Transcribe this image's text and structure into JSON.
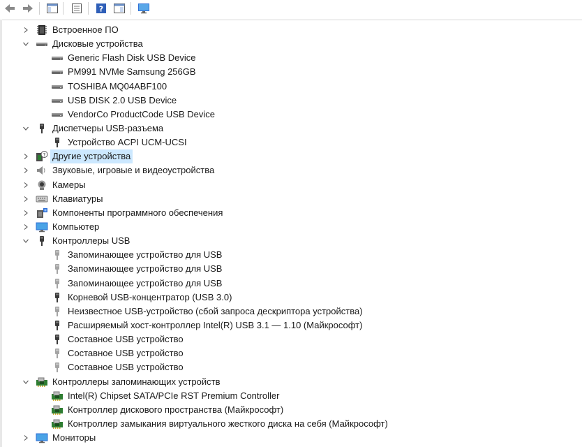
{
  "toolbar": {
    "buttons": [
      {
        "name": "back-icon"
      },
      {
        "name": "forward-icon"
      },
      {
        "name": "show-hide-console-tree-icon"
      },
      {
        "name": "properties-icon"
      },
      {
        "name": "help-icon"
      },
      {
        "name": "show-hide-action-pane-icon"
      },
      {
        "name": "monitor-icon"
      }
    ]
  },
  "tree": {
    "rows": [
      {
        "label": "Встроенное ПО",
        "level": 0,
        "expanded": false,
        "icon": "firmware-icon"
      },
      {
        "label": "Дисковые устройства",
        "level": 0,
        "expanded": true,
        "icon": "disk-drive-icon"
      },
      {
        "label": "Generic Flash Disk USB Device",
        "level": 1,
        "icon": "disk-drive-icon"
      },
      {
        "label": "PM991 NVMe Samsung 256GB",
        "level": 1,
        "icon": "disk-drive-icon"
      },
      {
        "label": "TOSHIBA MQ04ABF100",
        "level": 1,
        "icon": "disk-drive-icon"
      },
      {
        "label": "USB DISK 2.0 USB Device",
        "level": 1,
        "icon": "disk-drive-icon"
      },
      {
        "label": "VendorCo ProductCode USB Device",
        "level": 1,
        "icon": "disk-drive-icon"
      },
      {
        "label": "Диспетчеры USB-разъема",
        "level": 0,
        "expanded": true,
        "icon": "usb-connector-icon"
      },
      {
        "label": "Устройство ACPI UCM-UCSI",
        "level": 1,
        "icon": "usb-connector-icon"
      },
      {
        "label": "Другие устройства",
        "level": 0,
        "expanded": false,
        "icon": "unknown-device-icon",
        "selected": true
      },
      {
        "label": "Звуковые, игровые и видеоустройства",
        "level": 0,
        "expanded": false,
        "icon": "speaker-icon"
      },
      {
        "label": "Камеры",
        "level": 0,
        "expanded": false,
        "icon": "camera-icon"
      },
      {
        "label": "Клавиатуры",
        "level": 0,
        "expanded": false,
        "icon": "keyboard-icon"
      },
      {
        "label": "Компоненты программного обеспечения",
        "level": 0,
        "expanded": false,
        "icon": "software-component-icon"
      },
      {
        "label": "Компьютер",
        "level": 0,
        "expanded": false,
        "icon": "computer-icon"
      },
      {
        "label": "Контроллеры USB",
        "level": 0,
        "expanded": true,
        "icon": "usb-connector-icon"
      },
      {
        "label": "Запоминающее устройство для USB",
        "level": 1,
        "icon": "usb-plug-light-icon"
      },
      {
        "label": "Запоминающее устройство для USB",
        "level": 1,
        "icon": "usb-plug-light-icon"
      },
      {
        "label": "Запоминающее устройство для USB",
        "level": 1,
        "icon": "usb-plug-light-icon"
      },
      {
        "label": "Корневой USB-концентратор (USB 3.0)",
        "level": 1,
        "icon": "usb-plug-icon"
      },
      {
        "label": "Неизвестное USB-устройство (сбой запроса дескриптора устройства)",
        "level": 1,
        "icon": "usb-plug-light-icon"
      },
      {
        "label": "Расширяемый хост-контроллер Intel(R) USB 3.1 — 1.10 (Майкрософт)",
        "level": 1,
        "icon": "usb-plug-icon"
      },
      {
        "label": "Составное USB устройство",
        "level": 1,
        "icon": "usb-plug-icon"
      },
      {
        "label": "Составное USB устройство",
        "level": 1,
        "icon": "usb-plug-light-icon"
      },
      {
        "label": "Составное USB устройство",
        "level": 1,
        "icon": "usb-plug-light-icon"
      },
      {
        "label": "Контроллеры запоминающих устройств",
        "level": 0,
        "expanded": true,
        "icon": "storage-controller-icon"
      },
      {
        "label": "Intel(R) Chipset SATA/PCIe RST Premium Controller",
        "level": 1,
        "icon": "storage-controller-icon"
      },
      {
        "label": "Контроллер дискового пространства (Майкрософт)",
        "level": 1,
        "icon": "storage-controller-icon"
      },
      {
        "label": "Контроллер замыкания виртуального жесткого диска на себя (Майкрософт)",
        "level": 1,
        "icon": "storage-controller-icon"
      },
      {
        "label": "Мониторы",
        "level": 0,
        "expanded": false,
        "icon": "monitor-icon"
      }
    ]
  },
  "colors": {
    "selection": "#cce8ff",
    "text": "#1a1a1a",
    "icon_dark": "#3a3a3a",
    "icon_light": "#9a9a9a",
    "accent_blue": "#2f6fd6"
  }
}
